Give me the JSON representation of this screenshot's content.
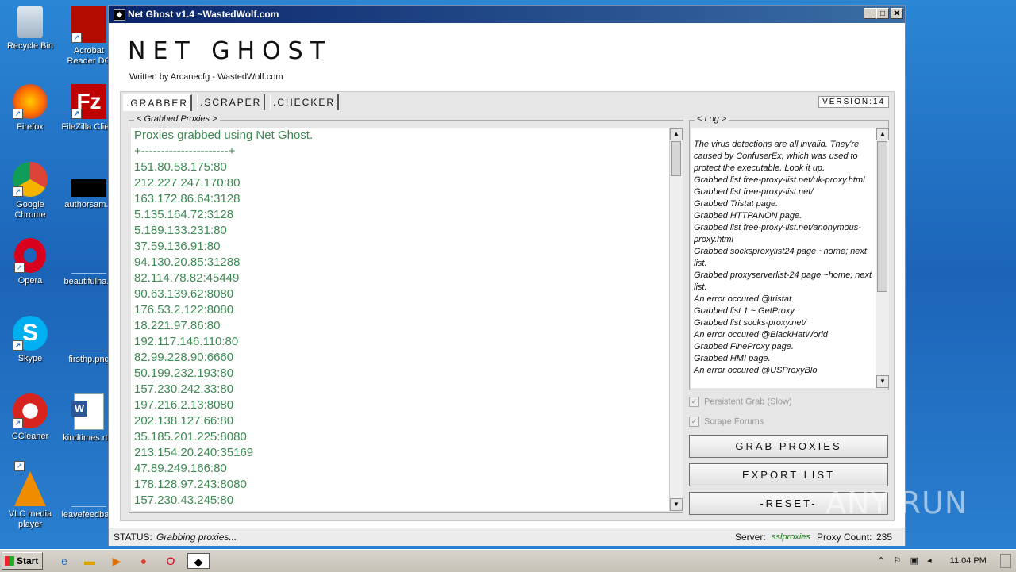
{
  "desktop_icons": [
    {
      "label": "Recycle Bin",
      "icon": "recycle-bin-icon"
    },
    {
      "label": "Acrobat Reader DC",
      "icon": "acrobat-icon"
    },
    {
      "label": "Firefox",
      "icon": "firefox-icon"
    },
    {
      "label": "FileZilla Client",
      "icon": "filezilla-icon"
    },
    {
      "label": "Google Chrome",
      "icon": "chrome-icon"
    },
    {
      "label": "authorsam...",
      "icon": "file-icon"
    },
    {
      "label": "Opera",
      "icon": "opera-icon"
    },
    {
      "label": "beautifulha...",
      "icon": "file-icon"
    },
    {
      "label": "Skype",
      "icon": "skype-icon"
    },
    {
      "label": "firsthp.png",
      "icon": "image-icon"
    },
    {
      "label": "CCleaner",
      "icon": "ccleaner-icon"
    },
    {
      "label": "kindtimes.rt...",
      "icon": "word-icon"
    },
    {
      "label": "VLC media player",
      "icon": "vlc-icon"
    },
    {
      "label": "leavefeedba...",
      "icon": "file-icon"
    }
  ],
  "window": {
    "title": "Net Ghost v1.4 ~WastedWolf.com",
    "minimize": "_",
    "maximize": "□",
    "close": "✕"
  },
  "app": {
    "title": "NET GHOST",
    "subtitle": "Written by Arcanecfg - WastedWolf.com",
    "version": "VERSION:14"
  },
  "tabs": [
    {
      "label": ".GRABBER",
      "active": true
    },
    {
      "label": ".SCRAPER",
      "active": false
    },
    {
      "label": ".CHECKER",
      "active": false
    }
  ],
  "grabbed": {
    "title": "< Grabbed Proxies >",
    "lines": [
      "Proxies grabbed using Net Ghost.",
      "+----------------------+",
      "151.80.58.175:80",
      "212.227.247.170:80",
      "163.172.86.64:3128",
      "5.135.164.72:3128",
      "5.189.133.231:80",
      "37.59.136.91:80",
      "94.130.20.85:31288",
      "82.114.78.82:45449",
      "90.63.139.62:8080",
      "176.53.2.122:8080",
      "18.221.97.86:80",
      "192.117.146.110:80",
      "82.99.228.90:6660",
      "50.199.232.193:80",
      "157.230.242.33:80",
      "197.216.2.13:8080",
      "202.138.127.66:80",
      "35.185.201.225:8080",
      "213.154.20.240:35169",
      "47.89.249.166:80",
      "178.128.97.243:8080",
      "157.230.43.245:80"
    ]
  },
  "log": {
    "title": "< Log >",
    "lines": [
      "The virus detections are all invalid. They're caused by ConfuserEx, which was used to protect the executable. Look it up.",
      "Grabbed list free-proxy-list.net/uk-proxy.html",
      "Grabbed list free-proxy-list.net/",
      "Grabbed Tristat page.",
      "Grabbed HTTPANON page.",
      "Grabbed list free-proxy-list.net/anonymous-proxy.html",
      "Grabbed socksproxylist24 page ~home; next list.",
      "Grabbed proxyserverlist-24 page ~home; next list.",
      "An error occured @tristat",
      "Grabbed list 1 ~ GetProxy",
      "Grabbed list socks-proxy.net/",
      "An error occured @BlackHatWorld",
      "Grabbed FineProxy page.",
      "Grabbed HMI page.",
      "An error occured @USProxyBlo"
    ]
  },
  "options": {
    "persistent_grab": "Persistent Grab (Slow)",
    "scrape_forums": "Scrape Forums"
  },
  "buttons": {
    "grab": "GRAB PROXIES",
    "export": "EXPORT LIST",
    "reset": "-RESET-"
  },
  "status": {
    "label": "STATUS:",
    "text": "Grabbing proxies...",
    "server_label": "Server:",
    "server_value": "sslproxies",
    "count_label": "Proxy Count:",
    "count_value": "235"
  },
  "watermark": "ANY RUN",
  "taskbar": {
    "start": "Start",
    "clock": "11:04 PM"
  }
}
